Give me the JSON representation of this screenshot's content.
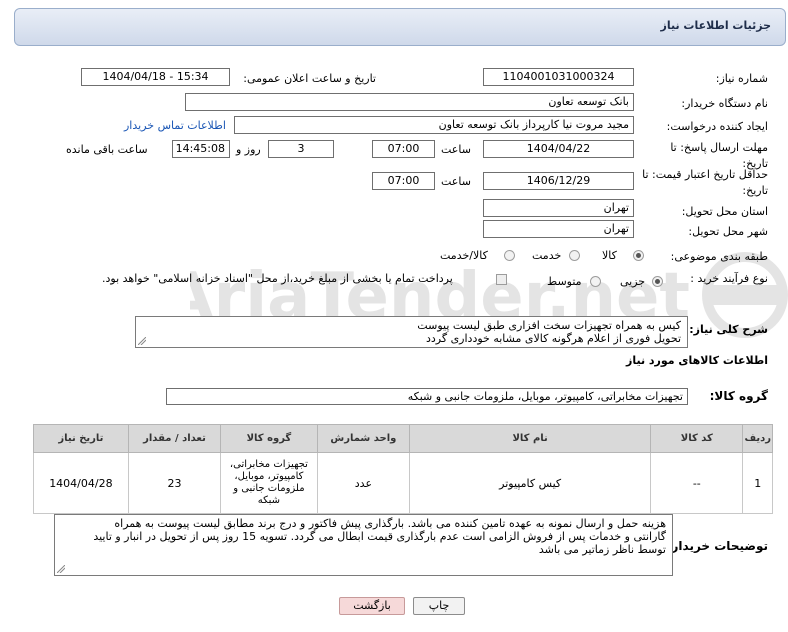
{
  "header": {
    "title": "جزئیات اطلاعات نیاز"
  },
  "fields": {
    "need_number_label": "شماره نیاز:",
    "need_number": "1104001031000324",
    "announce_label": "تاریخ و ساعت اعلان عمومی:",
    "announce_value": "1404/04/18 - 15:34",
    "buyer_org_label": "نام دستگاه خریدار:",
    "buyer_org": "بانک توسعه تعاون",
    "creator_label": "ایجاد کننده درخواست:",
    "creator": "مجید مروت نیا کارپرداز بانک توسعه تعاون",
    "contact_link": "اطلاعات تماس خریدار",
    "send_deadline_label": "مهلت ارسال پاسخ: تا تاریخ:",
    "send_date": "1404/04/22",
    "time_label": "ساعت",
    "send_time": "07:00",
    "days_value": "3",
    "days_label": "روز و",
    "remaining_time": "14:45:08",
    "remaining_label": "ساعت باقی مانده",
    "price_validity_label": "حداقل تاریخ اعتبار قیمت: تا تاریخ:",
    "price_date": "1406/12/29",
    "price_time": "07:00",
    "province_label": "استان محل تحویل:",
    "province": "تهران",
    "city_label": "شهر محل تحویل:",
    "city": "تهران",
    "category_label": "طبقه بندی موضوعی:",
    "category_options": [
      "کالا",
      "خدمت",
      "کالا/خدمت"
    ],
    "process_label": "نوع فرآیند خرید :",
    "process_options": [
      "جزیی",
      "متوسط"
    ],
    "payment_note": "پرداخت تمام یا بخشی از مبلغ خرید،از محل \"اسناد خزانه اسلامی\" خواهد بود."
  },
  "summary": {
    "label": "شرح کلی نیاز:",
    "line1": "کیس به همراه تجهیزات سخت افزاری طبق لیست پیوست",
    "line2": "تحویل فوری از اعلام هرگونه کالای مشابه خودداری گردد"
  },
  "goods_section": {
    "title": "اطلاعات کالاهای مورد نیاز",
    "group_label": "گروه کالا:",
    "group_value": "تجهیزات مخابراتی، کامپیوتر، موبایل، ملزومات جانبی و شبکه"
  },
  "table": {
    "headers": [
      "ردیف",
      "کد کالا",
      "نام کالا",
      "واحد شمارش",
      "گروه کالا",
      "تعداد / مقدار",
      "تاریخ نیاز"
    ],
    "rows": [
      [
        "1",
        "--",
        "کیس کامپیوتر",
        "عدد",
        "تجهیزات مخابراتی، کامپیوتر، موبایل، ملزومات جانبی و شبکه",
        "23",
        "1404/04/28"
      ]
    ]
  },
  "buyer_notes": {
    "label": "توضیحات خریدار:",
    "line1": "هزینه حمل و ارسال نمونه به عهده تامین کننده می باشد. بارگذاری پیش فاکتور و درج برند مطابق لیست پیوست به همراه",
    "line2": "گارانتی و خدمات پس از فروش الزامی است عدم بارگذاری قیمت ابطال می گردد. تسویه 15 روز پس از تحویل در انبار و تایید",
    "line3": "توسط ناظر زماتیر می باشد"
  },
  "buttons": {
    "print": "چاپ",
    "back": "بازگشت"
  },
  "colors": {
    "header_bg": "#cfd9ea",
    "link": "#1a56b5",
    "back_button": "#f6d9d9"
  }
}
